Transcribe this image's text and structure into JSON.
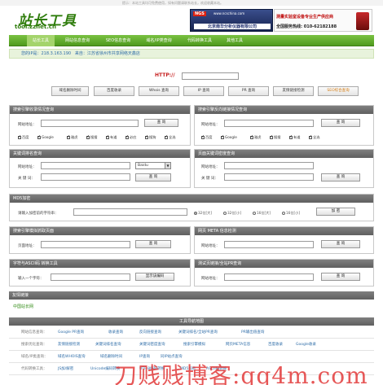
{
  "header": {
    "top_note": "提示：本站工具均可免费使用，如有问题请联系站长，欢迎收藏本站。",
    "logo_cn": "站长工具",
    "logo_en": "tool.zznet.cn",
    "ad_left": {
      "brand": "NGS",
      "url": "www.ncschina.com",
      "company": "北京南华分析仪器有限公司"
    },
    "ad_right": {
      "line1": "测量实验室设备专业生产供应商",
      "line2": "全国服务热线: 010-62182188"
    }
  },
  "nav": {
    "items": [
      "站长工具",
      "网站信息查询",
      "SEO信息查询",
      "域名/IP类查询",
      "代码转换工具",
      "其他工具"
    ],
    "active": 0
  },
  "infobar": {
    "ip_label": "您的IP是：",
    "ip": "218.3.163.190",
    "from_label": "来自：",
    "location": "江苏省徐州市共享网络天鑫店"
  },
  "query": {
    "http_label": "HTTP://",
    "buttons": [
      "域名删除时间",
      "百度收录",
      "Whois 查询",
      "IP 查询",
      "PR 查询",
      "友情链接检测",
      "SEO综合查询"
    ]
  },
  "panels": {
    "engine_index": {
      "title": "搜索引擎收录情况查询",
      "url_label": "网站地址：",
      "button": "查 询",
      "engines": [
        "百度",
        "Google",
        "雅虎",
        "搜搜",
        "有道",
        "必应",
        "搜狗",
        "全选"
      ]
    },
    "engine_backlink": {
      "title": "搜索引擎反向链接情况查询",
      "url_label": "网站地址：",
      "button": "查 询",
      "engines": [
        "百度",
        "Google",
        "雅虎",
        "搜搜",
        "有道",
        "全选"
      ]
    },
    "keyword_rank": {
      "title": "关键词排名查询",
      "url_label": "网站地址：",
      "kw_label": "关 键 词：",
      "engine_selected": "Baidu",
      "button": "查 询"
    },
    "keyword_density": {
      "title": "页面关键词密度查询",
      "url_label": "网站地址：",
      "kw_label": "关 键 词：",
      "button": "查 询"
    },
    "md5": {
      "title": "MD5加密",
      "input_label": "请输入加密前的字符串：",
      "options": [
        "32位[大]",
        "32位[小]",
        "16位[大]",
        "16位[小]"
      ],
      "selected": 0,
      "button": "加 密"
    },
    "simulate_spider": {
      "title": "搜索引擎模拟抓取页面",
      "url_label": "页面地址：",
      "button": "查 询"
    },
    "meta_check": {
      "title": "网页 META 信息检测",
      "url_label": "网站地址：",
      "button": "查 询"
    },
    "ascii": {
      "title": "字符与ASCII码 转换工具",
      "input_label": "输入一个字符：",
      "button": "显示该编码"
    },
    "site_pr": {
      "title": "测试页链接/全站PR查询",
      "url_label": "网站地址：",
      "button": "查 询"
    }
  },
  "friend_links": {
    "title": "友情链接",
    "items": [
      "中国站长网"
    ]
  },
  "toolnav": {
    "title": "工具导航地图",
    "rows": [
      {
        "cat": "网站信息查询：",
        "links": [
          "Google PR查询",
          "收录查询",
          "反向链接查询",
          "关键词排名/全站PR查询",
          "PR输出值查询"
        ]
      },
      {
        "cat": "搜索优化查询：",
        "links": [
          "友情链接检测",
          "关键词排名查询",
          "关键词密度查询",
          "搜索引擎模拟",
          "网页META信息",
          "百度收录",
          "Google收录"
        ]
      },
      {
        "cat": "域名/IP类查询：",
        "links": [
          "域名WHOIS查询",
          "域名删除时间",
          "IP查询",
          "同IP站点查询"
        ]
      },
      {
        "cat": "代码转换工具：",
        "links": [
          "JS加/解密",
          "Unicode编码转换",
          "UTF-8编码转换",
          "MD5加密",
          "ASCII码转换"
        ]
      }
    ]
  },
  "watermark": "刀贱贱博客:qq4m.com"
}
